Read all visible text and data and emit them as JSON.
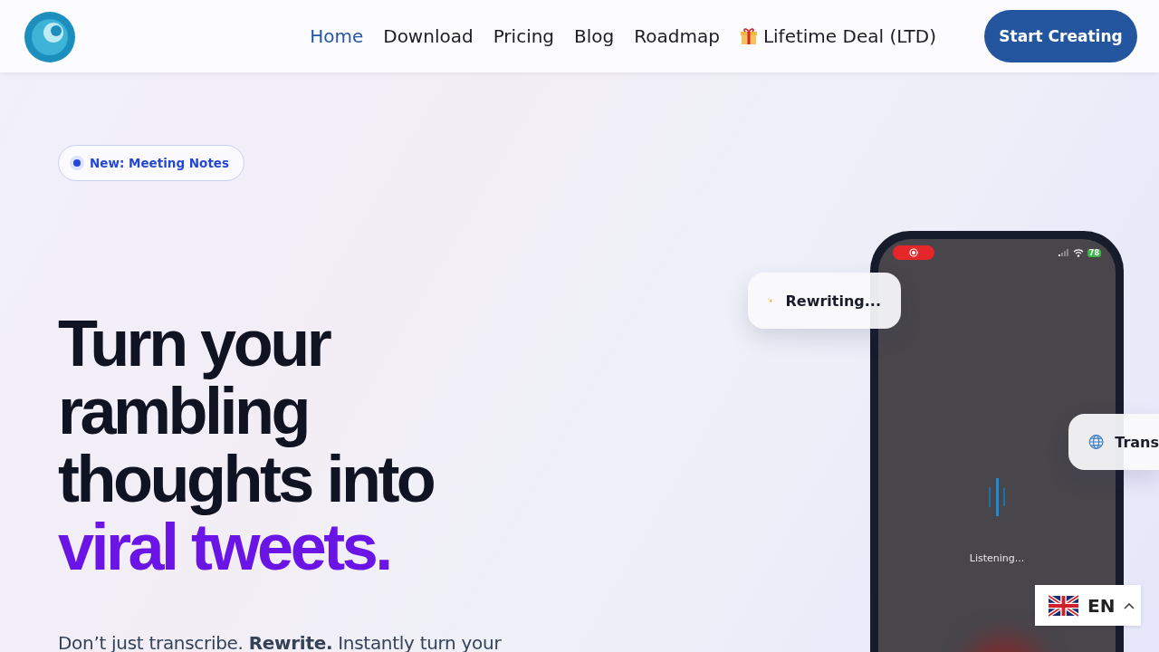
{
  "nav": {
    "items": [
      {
        "label": "Home",
        "selected": true
      },
      {
        "label": "Download",
        "selected": false
      },
      {
        "label": "Pricing",
        "selected": false
      },
      {
        "label": "Blog",
        "selected": false
      },
      {
        "label": "Roadmap",
        "selected": false
      },
      {
        "label": "Lifetime Deal (LTD)",
        "selected": false,
        "kind": "gift"
      }
    ],
    "cta": "Start Creating"
  },
  "hero": {
    "badge": "New: Meeting Notes",
    "headline": "Turn your rambling thoughts into",
    "headline_highlight": "viral tweets.",
    "subtitle": "Don’t just transcribe. **Rewrite.** Instantly turn your"
  },
  "phone": {
    "battery": "78",
    "status": "Listening...",
    "cards": [
      {
        "kind": "sparkle",
        "label": "Rewriting..."
      },
      {
        "kind": "globe",
        "label": "Trans"
      }
    ]
  },
  "language": {
    "code": "EN"
  }
}
